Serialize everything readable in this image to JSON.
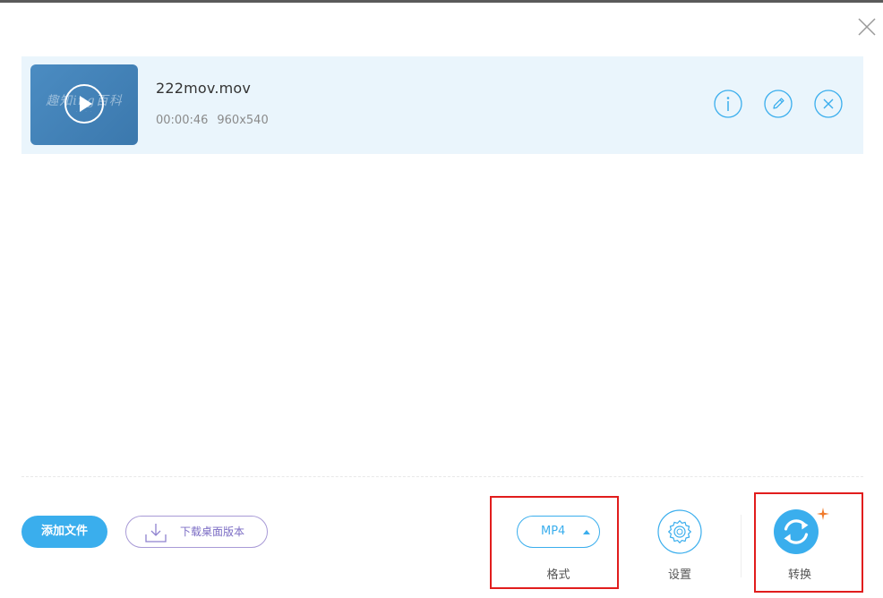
{
  "file": {
    "name": "222mov.mov",
    "duration": "00:00:46",
    "resolution": "960x540",
    "thumbnail_watermark": "趣知ing百科"
  },
  "toolbar": {
    "add_file_label": "添加文件",
    "download_desktop_label": "下载桌面版本",
    "format_value": "MP4",
    "format_label": "格式",
    "settings_label": "设置",
    "convert_label": "转换"
  },
  "icons": {
    "close": "close-icon",
    "play": "play-icon",
    "info": "info-icon",
    "edit": "pencil-icon",
    "remove": "remove-icon",
    "download": "download-icon",
    "caret": "caret-up-icon",
    "settings": "gear-icon",
    "convert": "convert-icon",
    "spark": "sparkle-icon"
  },
  "colors": {
    "accent": "#3aaeed",
    "row_background": "#eaf5fc",
    "download_accent": "#7b6cc4",
    "highlight_frame": "#e11d1d",
    "spark": "#f07a2b"
  }
}
